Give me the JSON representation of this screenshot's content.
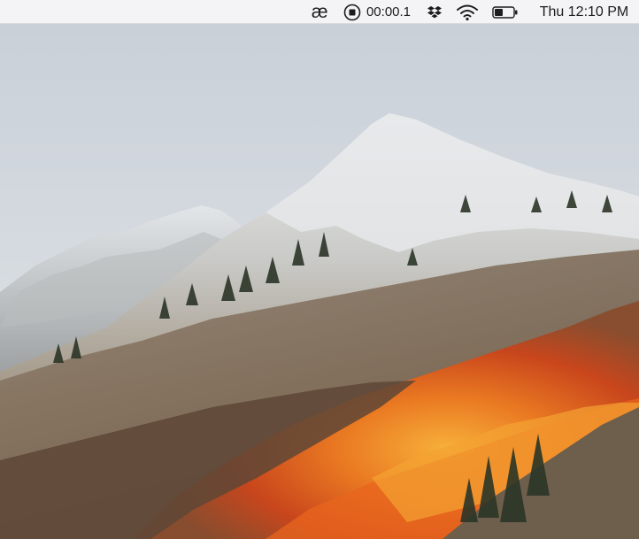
{
  "desktop": {
    "wallpaper": "mountain-wallpaper",
    "colors": {
      "sky": "#cfd5dc",
      "snow": "#e9ecef",
      "rock": "#8a8276",
      "autumn_orange": "#e2731f",
      "autumn_red": "#c8461b",
      "trees": "#2d3a2a"
    }
  },
  "menubar": {
    "background": "#f6f6f7",
    "app_extra_glyph": "æ",
    "recording": {
      "icon": "stop-record-icon",
      "time": "00:00.1"
    },
    "dropbox_icon": "dropbox-icon",
    "wifi_icon": "wifi-icon",
    "battery_icon": "battery-icon",
    "clock": "Thu 12:10 PM"
  }
}
